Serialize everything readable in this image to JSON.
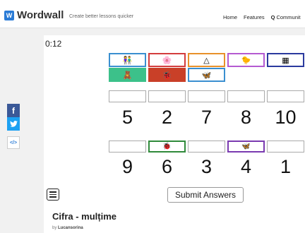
{
  "header": {
    "logo": "Wordwall",
    "tagline": "Create better lessons quicker",
    "nav": [
      "Home",
      "Features",
      "Communit"
    ]
  },
  "share": {
    "facebook": "f",
    "embed": "</>"
  },
  "activity": {
    "timer": "0:12",
    "tiles": [
      {
        "color": "#3a8fd0",
        "icon": "people-icon",
        "glyph": "👫"
      },
      {
        "color": "#d33c3c",
        "icon": "flower-icon",
        "glyph": "🌸"
      },
      {
        "color": "#e8912a",
        "icon": "triangle-dots-icon",
        "glyph": "△"
      },
      {
        "color": "#b45ad1",
        "icon": "chicks-icon",
        "glyph": "🐤"
      },
      {
        "color": "#2b3a9e",
        "icon": "pattern-icon",
        "glyph": "▦"
      },
      {
        "color": "#3cc18a",
        "icon": "toys-icon",
        "glyph": "🧸"
      },
      {
        "color": "#c94028",
        "icon": "ladybug-icon",
        "glyph": "🐞"
      },
      {
        "color": "#3a8fd0",
        "icon": "butterflies-icon",
        "glyph": "🦋"
      }
    ],
    "row1_numbers": [
      "5",
      "2",
      "7",
      "8",
      "10"
    ],
    "row2_numbers": [
      "9",
      "6",
      "3",
      "4",
      "1"
    ],
    "row2_placed": [
      null,
      {
        "color": "#2f8a3a",
        "icon": "ladybugs-icon",
        "glyph": "🐞"
      },
      null,
      {
        "color": "#7a3ab0",
        "icon": "butterflies-icon",
        "glyph": "🦋"
      },
      null
    ],
    "submit_label": "Submit Answers"
  },
  "footer": {
    "title": "Cifra - mulțime",
    "by_prefix": "by",
    "author": "Lucansorina"
  }
}
